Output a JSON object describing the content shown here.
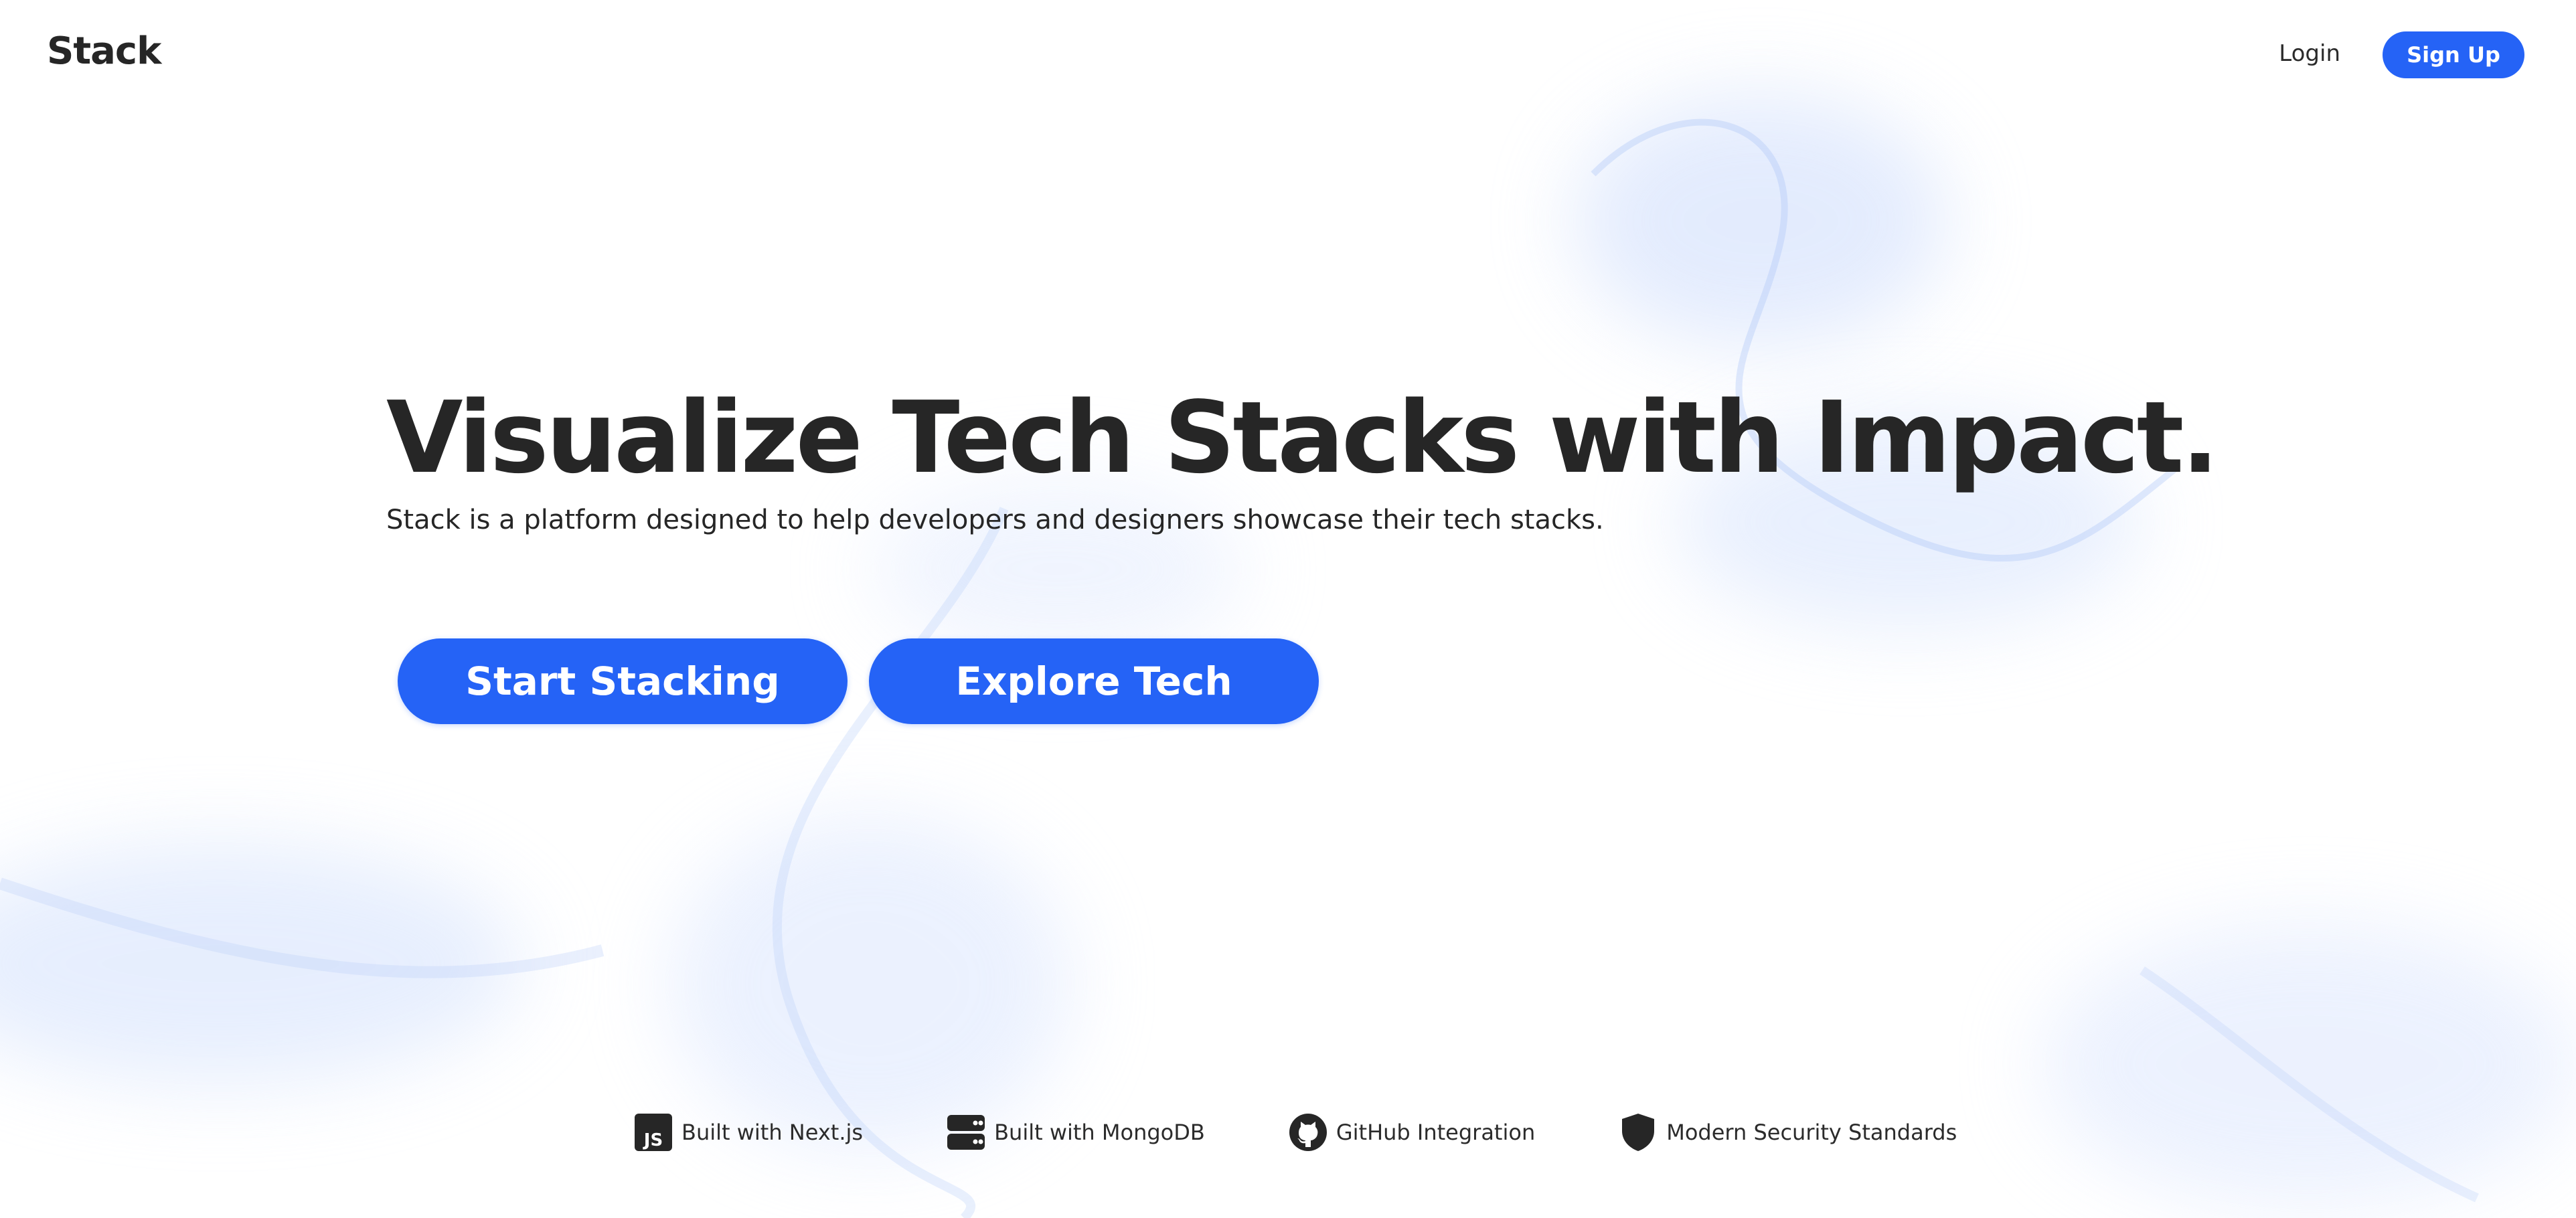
{
  "header": {
    "logo": "Stack",
    "login_label": "Login",
    "signup_label": "Sign Up"
  },
  "hero": {
    "title": "Visualize Tech Stacks with Impact.",
    "subtitle": "Stack is a platform designed to help developers and designers showcase their tech stacks.",
    "primary_cta": "Start Stacking",
    "secondary_cta": "Explore Tech"
  },
  "features": [
    {
      "icon": "javascript-icon",
      "label": "Built with Next.js"
    },
    {
      "icon": "database-server-icon",
      "label": "Built with MongoDB"
    },
    {
      "icon": "github-icon",
      "label": "GitHub Integration"
    },
    {
      "icon": "shield-icon",
      "label": "Modern Security Standards"
    }
  ],
  "colors": {
    "accent": "#2563f6",
    "text": "#262626",
    "background": "#ffffff",
    "smoke": "#bcd2fb"
  }
}
